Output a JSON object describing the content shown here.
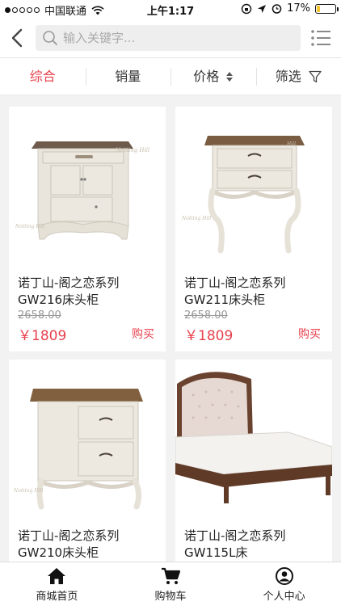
{
  "status_bar": {
    "carrier": "中国联通",
    "time": "上午1:17",
    "battery": "17%",
    "battery_level": 0.17,
    "signal_bars": 1
  },
  "header": {
    "search_placeholder": "输入关键字...",
    "icons": [
      "back-chevron-icon",
      "search-icon",
      "list-menu-icon"
    ]
  },
  "tabs": [
    {
      "label": "综合",
      "active": true
    },
    {
      "label": "销量",
      "active": false
    },
    {
      "label": "价格",
      "active": false,
      "icon": "sort-updown-icon"
    },
    {
      "label": "筛选",
      "active": false,
      "icon": "filter-icon"
    }
  ],
  "products": [
    {
      "name": "诺丁山-阁之恋系列GW216床头柜",
      "old_price": "2658.00",
      "price": "￥1809",
      "buy": "购买",
      "image": "nightstand-small-drawer"
    },
    {
      "name": "诺丁山-阁之恋系列GW211床头柜",
      "old_price": "2658.00",
      "price": "￥1809",
      "buy": "购买",
      "image": "nightstand-two-drawers"
    },
    {
      "name": "诺丁山-阁之恋系列GW210床头柜",
      "old_price": "",
      "price": "",
      "buy": "",
      "image": "nightstand-wide-two-drawers"
    },
    {
      "name": "诺丁山-阁之恋系列GW115L床",
      "old_price": "",
      "price": "",
      "buy": "",
      "image": "upholstered-bed"
    }
  ],
  "bottom_nav": [
    {
      "label": "商城首页",
      "icon": "home-icon"
    },
    {
      "label": "购物车",
      "icon": "cart-icon"
    },
    {
      "label": "个人中心",
      "icon": "user-icon"
    }
  ],
  "colors": {
    "accent": "#e8414e",
    "background": "#f2f2f2"
  }
}
